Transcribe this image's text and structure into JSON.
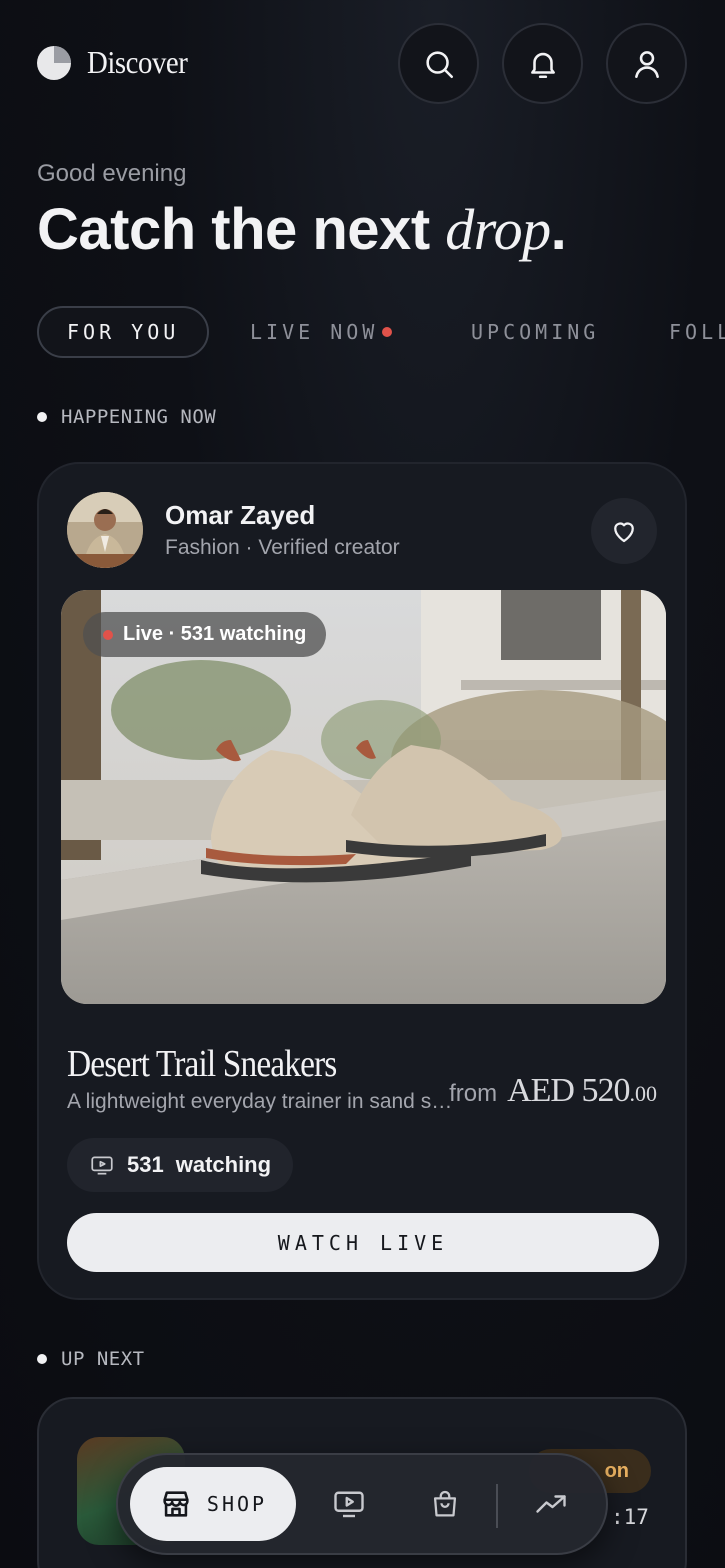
{
  "header": {
    "title": "Discover",
    "icons": [
      "search-icon",
      "bell-icon",
      "profile-icon"
    ]
  },
  "greeting": "Good evening",
  "headline": {
    "main": "Catch the next ",
    "italic": "drop",
    "suffix": "."
  },
  "tabs": [
    {
      "label": "FOR YOU",
      "active": true
    },
    {
      "label": "LIVE NOW",
      "active": false
    },
    {
      "label": "UPCOMING",
      "active": false
    },
    {
      "label": "FOLL",
      "active": false
    }
  ],
  "sections": {
    "happening_now": "HAPPENING NOW",
    "up_next": "UP NEXT"
  },
  "live_card": {
    "creator_name": "Omar Zayed",
    "creator_category": "Fashion",
    "creator_status": "Verified creator",
    "live_pill": "Live · 531 watching",
    "product_title": "Desert Trail Sneakers",
    "product_desc": "A lightweight everyday trainer in sand suede",
    "price_prefix": "from",
    "price_amount": "AED 520",
    "price_cents": ".00",
    "watch_count": "531",
    "watch_label": "watching",
    "cta": "WATCH LIVE"
  },
  "up_next_card": {
    "badge": "on",
    "time": ":17"
  },
  "bottom_nav": {
    "shop_label": "SHOP",
    "items": [
      "shop-icon",
      "video-icon",
      "bag-icon",
      "trending-icon"
    ]
  },
  "colors": {
    "live": "#e0524a",
    "accent_badge": "#e8b060",
    "bg": "#0e1016"
  }
}
